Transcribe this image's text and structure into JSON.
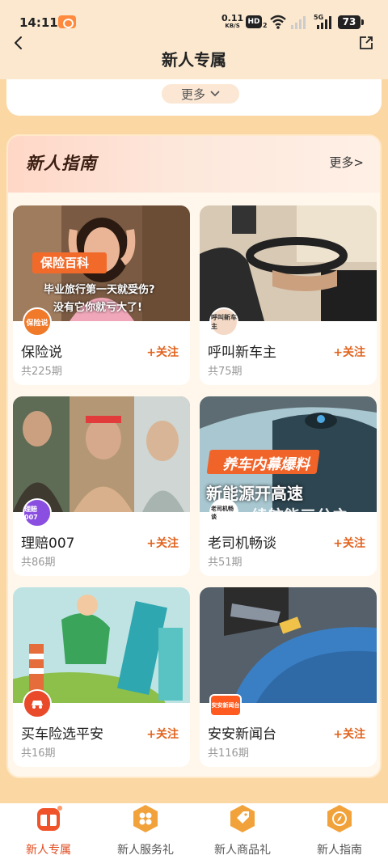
{
  "status_bar": {
    "time": "14:11",
    "net_speed": "0.11",
    "net_unit": "KB/S",
    "hd": "HD",
    "hd_sub": "2",
    "sig_5g": "5G",
    "battery": "73"
  },
  "header": {
    "title": "新人专属"
  },
  "prev_section": {
    "more_label": "更多"
  },
  "guide": {
    "title": "新人指南",
    "more_label": "更多>",
    "cards": [
      {
        "name": "保险说",
        "count": "共225期",
        "follow": "+关注",
        "banner": "保险百科",
        "caption1": "毕业旅行第一天就受伤?",
        "caption2": "没有它你就亏大了!",
        "badge": "保险说",
        "badge_color": "#f07a2a"
      },
      {
        "name": "呼叫新车主",
        "count": "共75期",
        "follow": "+关注",
        "badge": "呼叫新车主",
        "badge_color": "#f3d9c6"
      },
      {
        "name": "理赔007",
        "count": "共86期",
        "follow": "+关注",
        "badge": "理赔007",
        "badge_color": "#8a4fe0"
      },
      {
        "name": "老司机畅谈",
        "count": "共51期",
        "follow": "+关注",
        "banner": "养车内幕爆料",
        "caption1": "新能源开高速",
        "caption2": "续航能三分之",
        "badge": "老司机畅谈",
        "badge_color": "#ffffff"
      },
      {
        "name": "买车险选平安",
        "count": "共16期",
        "follow": "+关注",
        "badge_color": "#e94a2a"
      },
      {
        "name": "安安新闻台",
        "count": "共116期",
        "follow": "+关注",
        "badge": "安安新闻台",
        "badge_color": "#ff5a1f"
      }
    ]
  },
  "tabbar": {
    "items": [
      {
        "label": "新人专属"
      },
      {
        "label": "新人服务礼"
      },
      {
        "label": "新人商品礼"
      },
      {
        "label": "新人指南"
      }
    ]
  },
  "colors": {
    "accent": "#e04a1e",
    "follow": "#e2641f",
    "page_bg": "#fbd7a4"
  }
}
